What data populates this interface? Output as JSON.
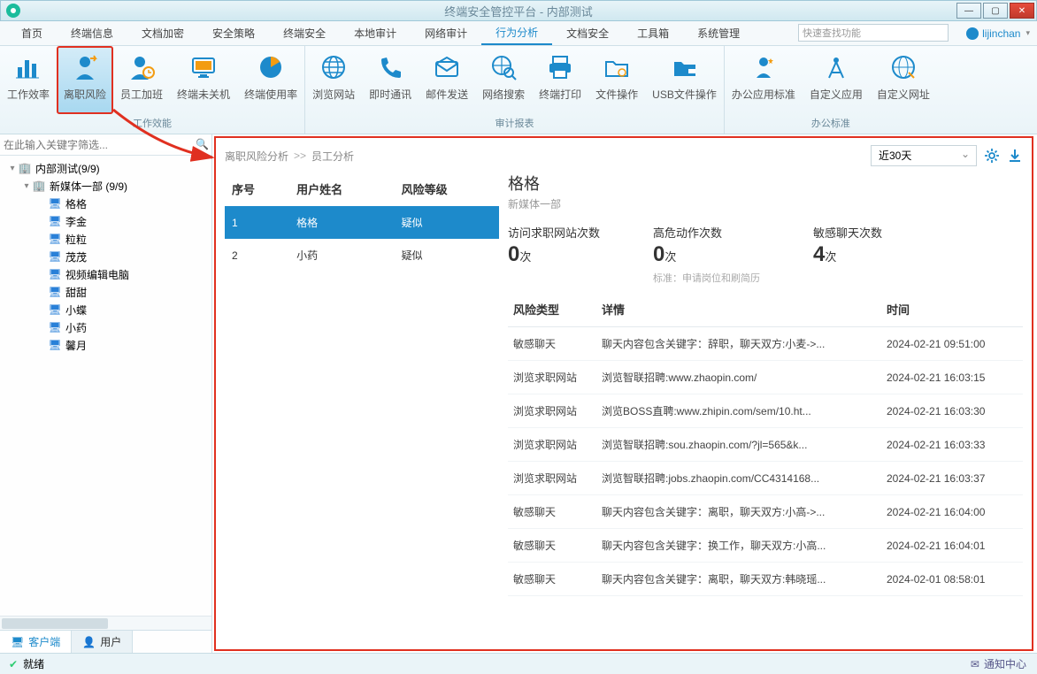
{
  "window": {
    "title": "终端安全管控平台 - 内部测试"
  },
  "menu": {
    "items": [
      "首页",
      "终端信息",
      "文档加密",
      "安全策略",
      "终端安全",
      "本地审计",
      "网络审计",
      "行为分析",
      "文档安全",
      "工具箱",
      "系统管理"
    ],
    "active_index": 7,
    "search_placeholder": "快速查找功能",
    "user": "lijinchan"
  },
  "ribbon": {
    "groups": [
      {
        "label": "工作效能",
        "items": [
          "工作效率",
          "离职风险",
          "员工加班",
          "终端未关机",
          "终端使用率"
        ],
        "highlight_index": 1
      },
      {
        "label": "审计报表",
        "items": [
          "浏览网站",
          "即时通讯",
          "邮件发送",
          "网络搜索",
          "终端打印",
          "文件操作",
          "USB文件操作"
        ]
      },
      {
        "label": "办公标准",
        "items": [
          "办公应用标准",
          "自定义应用",
          "自定义网址"
        ]
      }
    ]
  },
  "sidebar": {
    "filter_placeholder": "在此输入关键字筛选...",
    "root": {
      "label": "内部测试(9/9)"
    },
    "group": {
      "label": "新媒体一部 (9/9)"
    },
    "clients": [
      "格格",
      "李金",
      "粒粒",
      "茂茂",
      "视频编辑电脑",
      "甜甜",
      "小蝶",
      "小药",
      "馨月"
    ],
    "tabs": {
      "client": "客户端",
      "user": "用户"
    }
  },
  "content": {
    "breadcrumb": [
      "离职风险分析",
      "员工分析"
    ],
    "bc_sep": ">>",
    "range": "近30天",
    "emp_headers": [
      "序号",
      "用户姓名",
      "风险等级"
    ],
    "employees": [
      {
        "idx": "1",
        "name": "格格",
        "level": "疑似"
      },
      {
        "idx": "2",
        "name": "小药",
        "level": "疑似"
      }
    ],
    "detail": {
      "name": "格格",
      "dept": "新媒体一部",
      "stats": [
        {
          "label": "访问求职网站次数",
          "value": "0",
          "unit": "次",
          "note": ""
        },
        {
          "label": "高危动作次数",
          "value": "0",
          "unit": "次",
          "note": "标准：申请岗位和刷简历"
        },
        {
          "label": "敏感聊天次数",
          "value": "4",
          "unit": "次",
          "note": ""
        }
      ],
      "risk_headers": [
        "风险类型",
        "详情",
        "时间"
      ],
      "risks": [
        {
          "type": "敏感聊天",
          "detail": "聊天内容包含关键字：辞职，聊天双方:小麦->...",
          "time": "2024-02-21 09:51:00"
        },
        {
          "type": "浏览求职网站",
          "detail": "浏览智联招聘:www.zhaopin.com/",
          "time": "2024-02-21 16:03:15"
        },
        {
          "type": "浏览求职网站",
          "detail": "浏览BOSS直聘:www.zhipin.com/sem/10.ht...",
          "time": "2024-02-21 16:03:30"
        },
        {
          "type": "浏览求职网站",
          "detail": "浏览智联招聘:sou.zhaopin.com/?jl=565&k...",
          "time": "2024-02-21 16:03:33"
        },
        {
          "type": "浏览求职网站",
          "detail": "浏览智联招聘:jobs.zhaopin.com/CC4314168...",
          "time": "2024-02-21 16:03:37"
        },
        {
          "type": "敏感聊天",
          "detail": "聊天内容包含关键字：离职，聊天双方:小高->...",
          "time": "2024-02-21 16:04:00"
        },
        {
          "type": "敏感聊天",
          "detail": "聊天内容包含关键字：换工作，聊天双方:小高...",
          "time": "2024-02-21 16:04:01"
        },
        {
          "type": "敏感聊天",
          "detail": "聊天内容包含关键字：离职，聊天双方:韩晓瑶...",
          "time": "2024-02-01 08:58:01"
        }
      ]
    }
  },
  "statusbar": {
    "ready": "就绪",
    "notif": "通知中心"
  }
}
